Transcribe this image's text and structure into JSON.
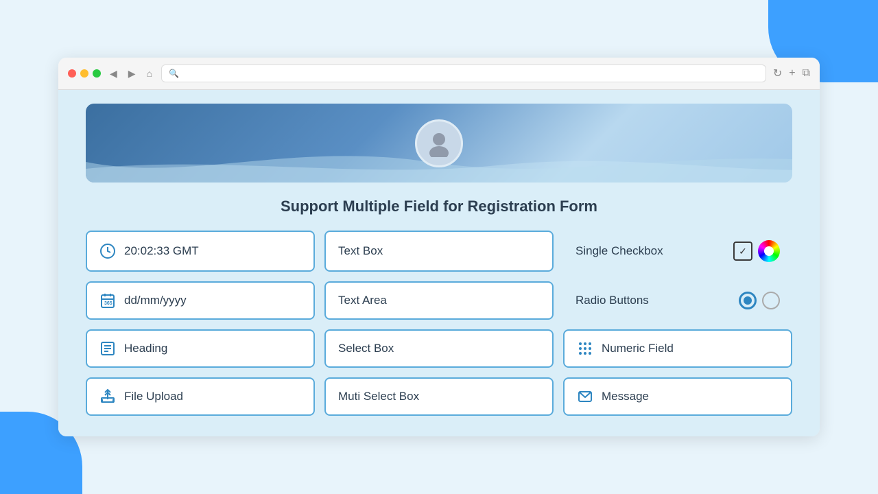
{
  "decorations": {
    "corner_top_right": "corner-top-right",
    "corner_bottom_left": "corner-bottom-left"
  },
  "browser": {
    "traffic_lights": [
      "red",
      "yellow",
      "green"
    ],
    "nav": [
      "◀",
      "▶",
      "⌂"
    ],
    "search_icon": "🔍",
    "refresh_icon": "↻",
    "new_tab_icon": "+",
    "copy_icon": "⧉"
  },
  "page": {
    "title": "Support Multiple Field for Registration Form"
  },
  "fields": [
    {
      "id": "clock",
      "icon": "🕐",
      "label": "20:02:33 GMT",
      "type": "icon-btn"
    },
    {
      "id": "textbox",
      "icon": null,
      "label": "Text Box",
      "type": "plain-btn"
    },
    {
      "id": "single-checkbox",
      "label": "Single Checkbox",
      "type": "checkbox"
    },
    {
      "id": "date",
      "icon": "📅",
      "label": "dd/mm/yyyy",
      "type": "icon-btn"
    },
    {
      "id": "textarea",
      "icon": null,
      "label": "Text Area",
      "type": "plain-btn"
    },
    {
      "id": "radio-buttons",
      "label": "Radio Buttons",
      "type": "radio"
    },
    {
      "id": "heading",
      "icon": "≡",
      "label": "Heading",
      "type": "icon-btn"
    },
    {
      "id": "selectbox",
      "icon": null,
      "label": "Select Box",
      "type": "plain-btn"
    },
    {
      "id": "numeric-field",
      "icon": "⠿",
      "label": "Numeric Field",
      "type": "icon-btn2"
    },
    {
      "id": "file-upload",
      "icon": "↑",
      "label": "File Upload",
      "type": "upload-btn"
    },
    {
      "id": "multi-select",
      "icon": null,
      "label": "Muti Select Box",
      "type": "plain-btn"
    },
    {
      "id": "message",
      "icon": "✉",
      "label": "Message",
      "type": "icon-btn"
    }
  ]
}
